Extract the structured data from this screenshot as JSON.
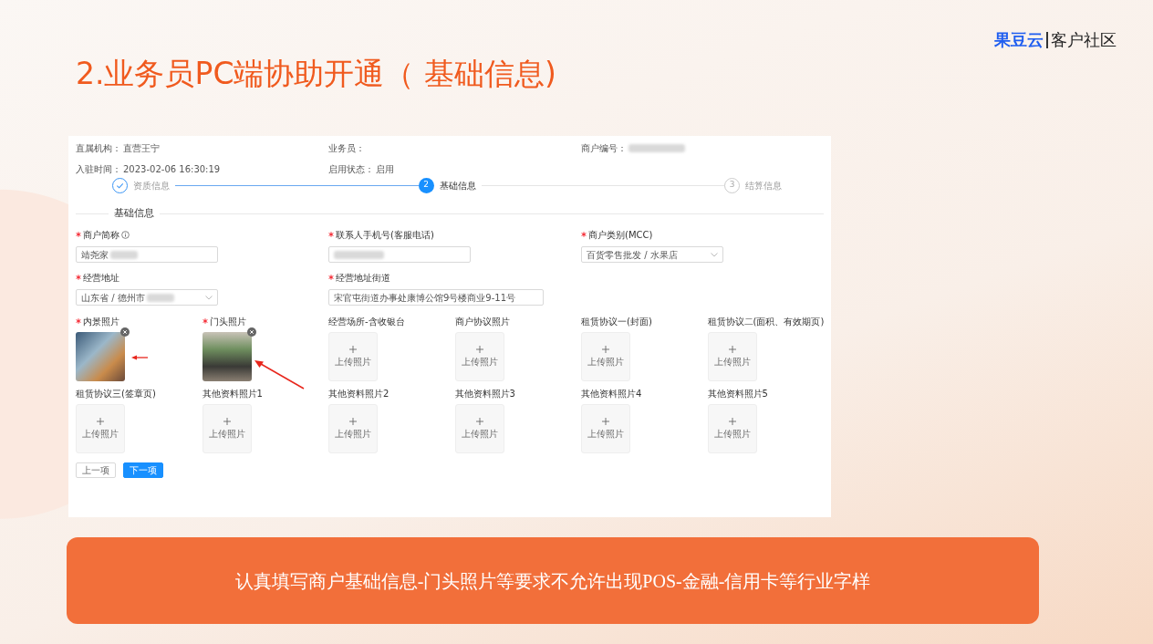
{
  "slide_title": "2.业务员PC端协助开通（ 基础信息)",
  "logo": {
    "brand": "果豆云",
    "tagline": "客户社区"
  },
  "header_info": [
    {
      "label": "直属机构：",
      "value": "直营王宁",
      "redacted": false
    },
    {
      "label": "业务员：",
      "redacted": false
    },
    {
      "label": "商户编号：",
      "redacted": true
    },
    {
      "label": "入驻时间：",
      "value": "2023-02-06 16:30:19",
      "redacted": false
    },
    {
      "label": "启用状态：",
      "value": "启用",
      "redacted": false
    }
  ],
  "steps": [
    {
      "done": true,
      "selected": false,
      "label": "资质信息"
    },
    {
      "done": false,
      "selected": true,
      "number": "2",
      "label": "基础信息"
    },
    {
      "done": false,
      "selected": false,
      "number": "3",
      "label": "结算信息"
    }
  ],
  "section_title": "基础信息",
  "fields": [
    {
      "label": "商户简称",
      "required": true,
      "info_icon": true,
      "kind": "text",
      "value": "靖尧家",
      "redacted": true
    },
    {
      "label": "联系人手机号(客服电话)",
      "required": true,
      "info_icon": false,
      "kind": "text",
      "redacted": true
    },
    {
      "label": "商户类别(MCC)",
      "required": true,
      "info_icon": false,
      "kind": "select",
      "value": "百货零售批发 / 水果店",
      "redacted": false
    },
    {
      "label": "经营地址",
      "required": true,
      "info_icon": false,
      "kind": "select",
      "value": "山东省 / 德州市",
      "redacted": true
    },
    {
      "label": "经营地址街道",
      "required": true,
      "info_icon": false,
      "kind": "text",
      "value": "宋官屯街道办事处康博公馆9号楼商业9-11号",
      "redacted": false
    }
  ],
  "photos": [
    {
      "label": "内景照片",
      "required": true,
      "uploaded": true,
      "arrow": true
    },
    {
      "label": "门头照片",
      "required": true,
      "uploaded": true,
      "arrow": true
    },
    {
      "label": "经营场所-含收银台",
      "required": false,
      "uploaded": false,
      "upload_text": "上传照片"
    },
    {
      "label": "商户协议照片",
      "required": false,
      "uploaded": false,
      "upload_text": "上传照片"
    },
    {
      "label": "租赁协议一(封面)",
      "required": false,
      "uploaded": false,
      "upload_text": "上传照片"
    },
    {
      "label": "租赁协议二(面积、有效期页)",
      "required": false,
      "uploaded": false,
      "upload_text": "上传照片"
    },
    {
      "label": "租赁协议三(签章页)",
      "required": false,
      "uploaded": false,
      "upload_text": "上传照片"
    },
    {
      "label": "其他资料照片1",
      "required": false,
      "uploaded": false,
      "upload_text": "上传照片"
    },
    {
      "label": "其他资料照片2",
      "required": false,
      "uploaded": false,
      "upload_text": "上传照片"
    },
    {
      "label": "其他资料照片3",
      "required": false,
      "uploaded": false,
      "upload_text": "上传照片"
    },
    {
      "label": "其他资料照片4",
      "required": false,
      "uploaded": false,
      "upload_text": "上传照片"
    },
    {
      "label": "其他资料照片5",
      "required": false,
      "uploaded": false,
      "upload_text": "上传照片"
    }
  ],
  "buttons": [
    {
      "label": "上一项",
      "primary": false
    },
    {
      "label": "下一项",
      "primary": true
    }
  ],
  "banner": "认真填写商户基础信息-门头照片等要求不允许出现POS-金融-信用卡等行业字样"
}
